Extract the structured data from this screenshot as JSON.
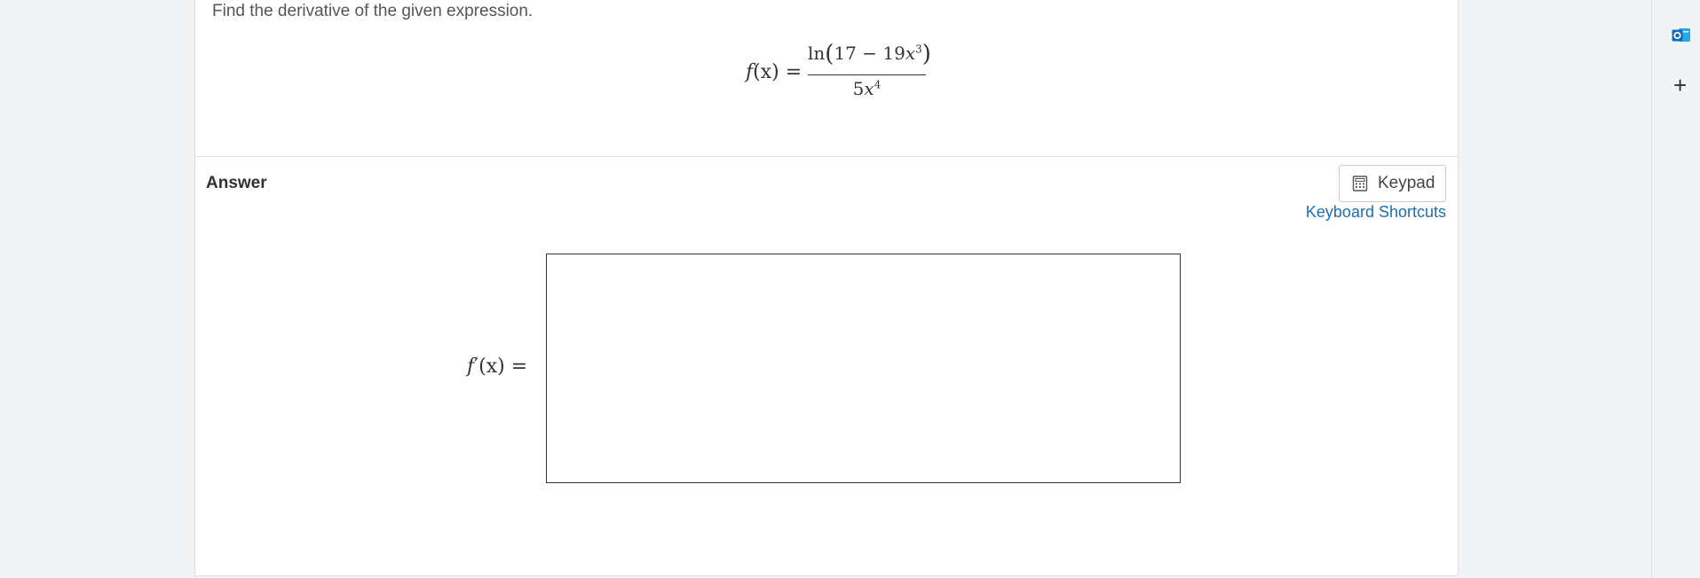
{
  "question": {
    "prompt": "Find the derivative of the given expression.",
    "expression": {
      "lhs_func": "f",
      "lhs_arg": "(x)",
      "equals": "=",
      "numerator": {
        "ln": "ln",
        "open_paren": "(",
        "constant": "17 − 19",
        "variable": "x",
        "exponent": "3",
        "close_paren": ")"
      },
      "denominator": {
        "coefficient": "5",
        "variable": "x",
        "exponent": "4"
      }
    }
  },
  "answer": {
    "label": "Answer",
    "keypad_label": "Keypad",
    "shortcuts_label": "Keyboard Shortcuts",
    "derivative_func": "f",
    "derivative_prime": "′",
    "derivative_arg": "(x)",
    "derivative_equals": "=",
    "input_value": ""
  },
  "icons": {
    "keypad": "calculator-icon",
    "outlook": "outlook-icon",
    "add": "plus-icon"
  },
  "colors": {
    "link": "#1a6fb5",
    "outlook_blue": "#0f6cbd",
    "background": "#f1f3f5"
  },
  "right_rail": {
    "plus": "+"
  }
}
